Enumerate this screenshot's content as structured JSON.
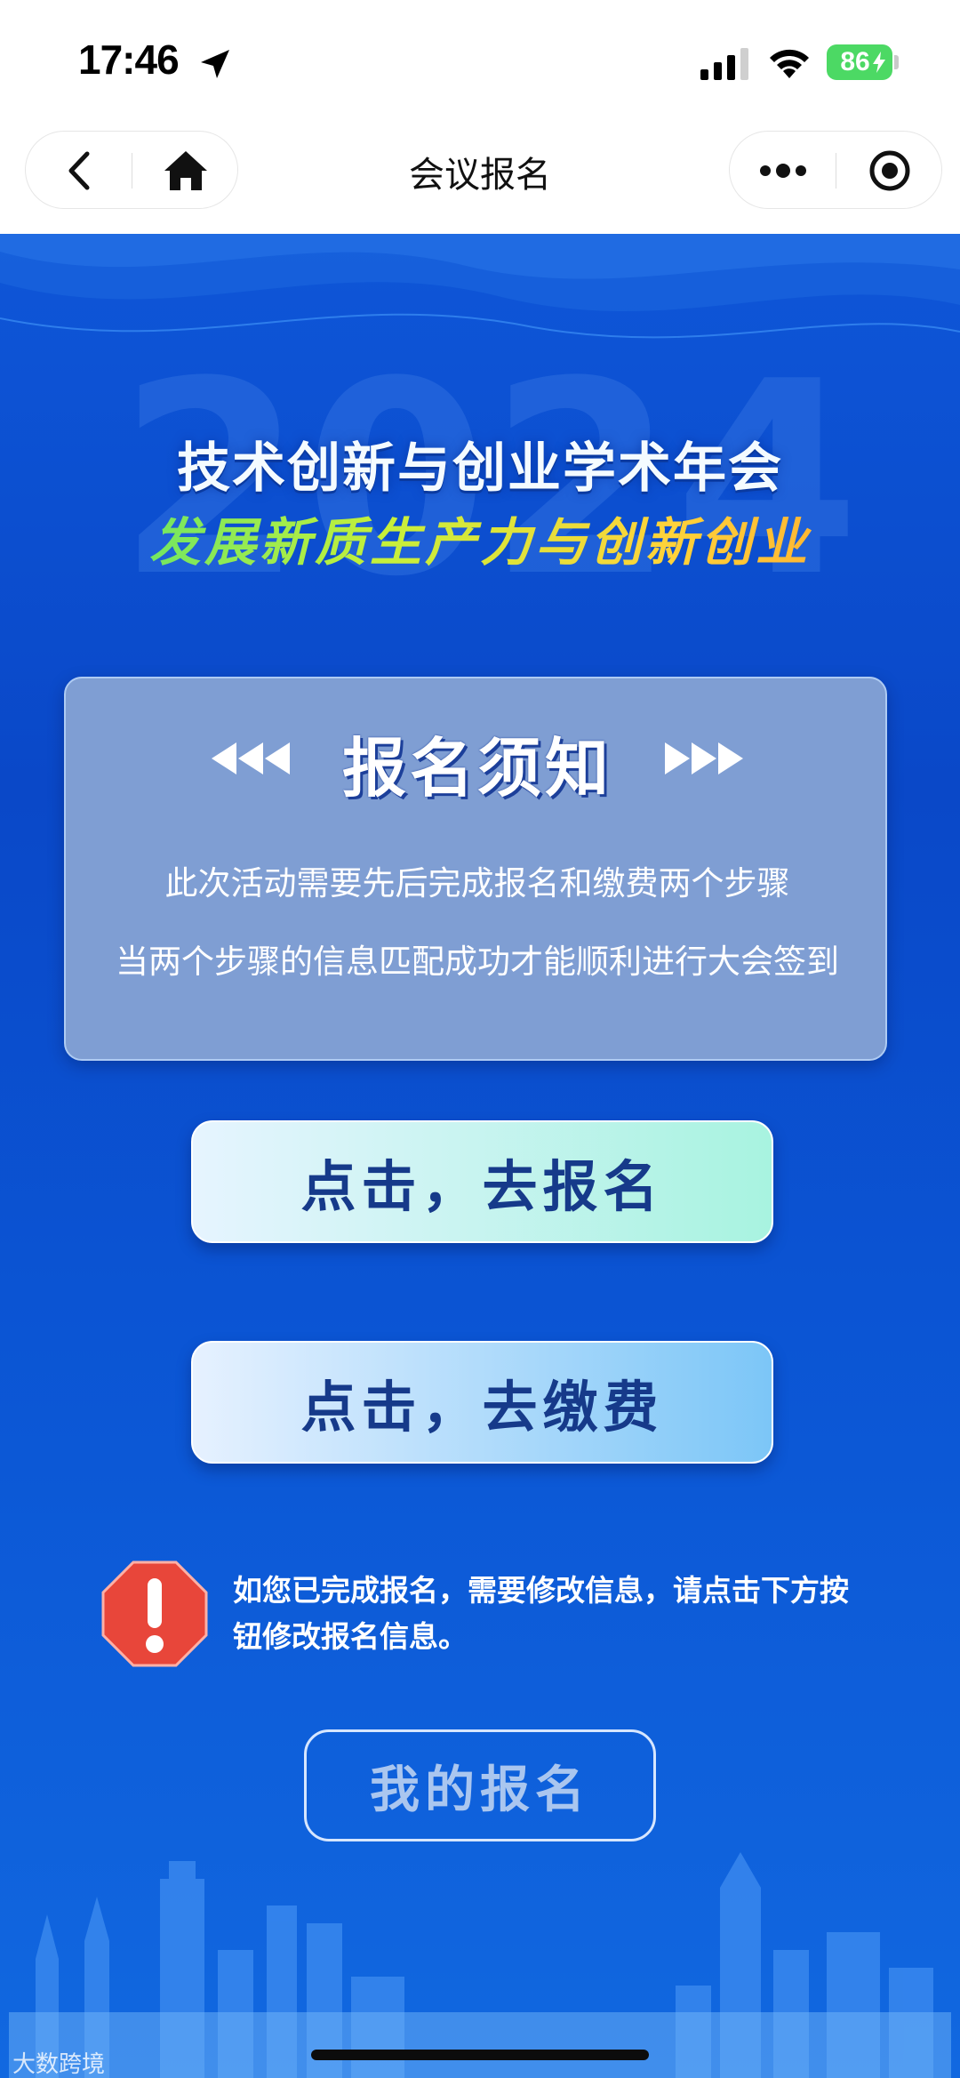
{
  "status_bar": {
    "time": "17:46",
    "battery": "86",
    "icons": [
      "location-arrow-icon",
      "cellular-signal-icon",
      "wifi-icon",
      "battery-charging-icon"
    ]
  },
  "nav": {
    "title": "会议报名",
    "back_icon": "chevron-left-icon",
    "home_icon": "home-icon",
    "more_icon": "more-dots-icon",
    "close_icon": "target-close-icon"
  },
  "banner": {
    "year_watermark": "2024",
    "headline": "技术创新与创业学术年会",
    "slogan": "发展新质生产力与创新创业"
  },
  "notice": {
    "title": "报名须知",
    "line1": "此次活动需要先后完成报名和缴费两个步骤",
    "line2": "当两个步骤的信息匹配成功才能顺利进行大会签到"
  },
  "actions": {
    "register": "点击，去报名",
    "pay": "点击，去缴费",
    "my_registration": "我的报名"
  },
  "tip": {
    "icon": "warning-exclamation-icon",
    "text": "如您已完成报名，需要修改信息，请点击下方按钮修改报名信息。"
  },
  "watermark": "大数跨境",
  "colors": {
    "background_blue": "#0a4fd1",
    "card": "#7f9ed3",
    "button_text": "#163a8a",
    "warning_red": "#e8463a"
  }
}
